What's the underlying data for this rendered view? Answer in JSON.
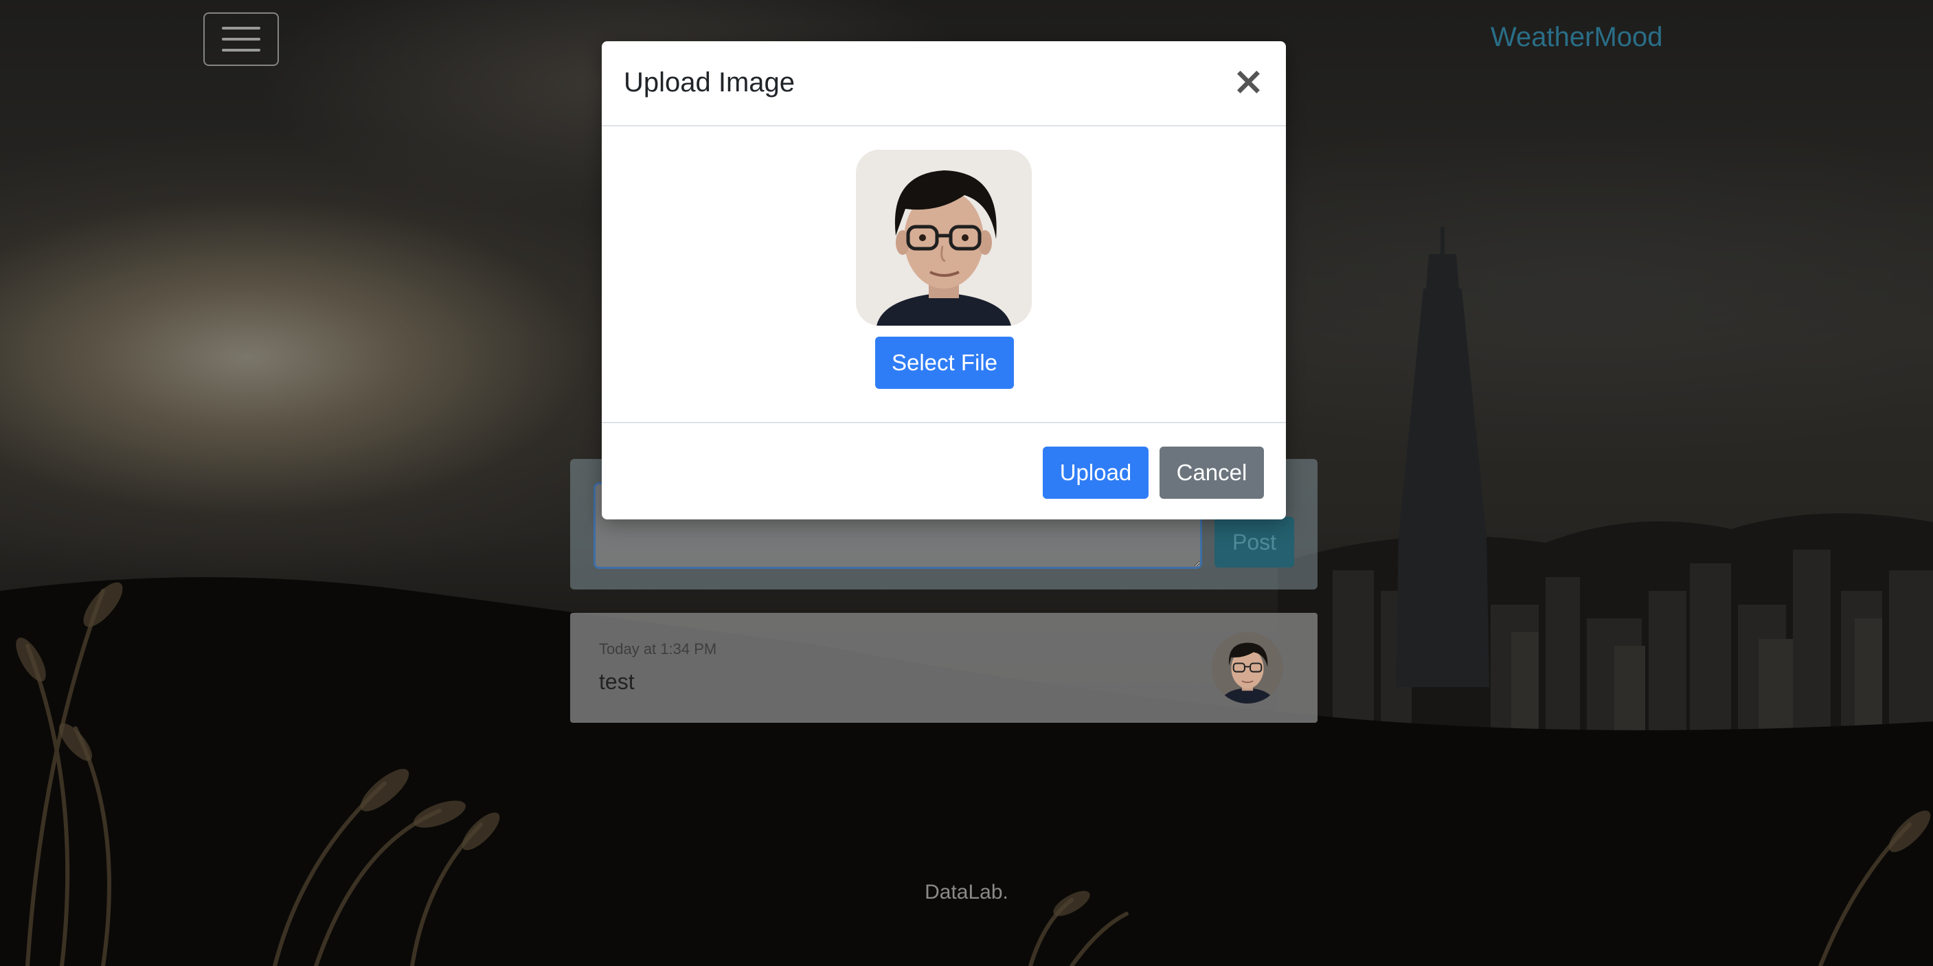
{
  "navbar": {
    "brand": "WeatherMood",
    "toggler_icon": "hamburger-menu-icon"
  },
  "composer": {
    "textarea_value": "",
    "post_label": "Post"
  },
  "posts": [
    {
      "time": "Today at 1:34 PM",
      "text": "test"
    }
  ],
  "footer": {
    "text": "DataLab."
  },
  "modal": {
    "title": "Upload Image",
    "close_label": "×",
    "select_label": "Select File",
    "upload_label": "Upload",
    "cancel_label": "Cancel"
  },
  "colors": {
    "primary": "#2f7df6",
    "secondary": "#6c757d",
    "brand": "#2a6e88",
    "post_button": "#24606f"
  }
}
